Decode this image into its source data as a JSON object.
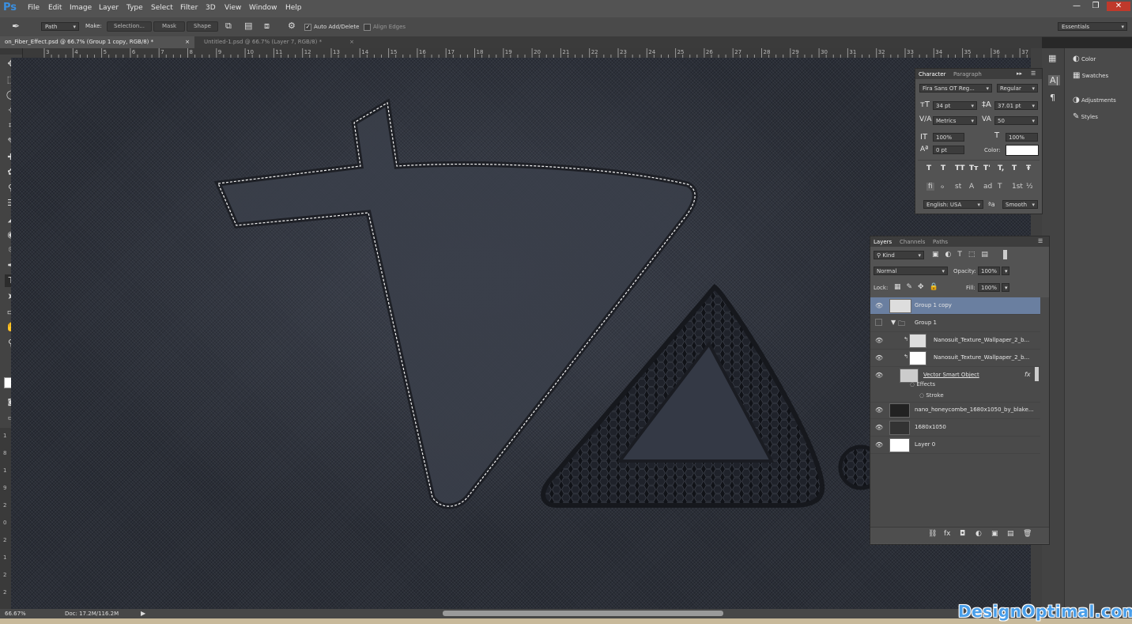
{
  "app": {
    "logo": "Ps"
  },
  "menu": [
    "File",
    "Edit",
    "Image",
    "Layer",
    "Type",
    "Select",
    "Filter",
    "3D",
    "View",
    "Window",
    "Help"
  ],
  "window_controls": [
    "—",
    "❐",
    "✕"
  ],
  "options": {
    "mode": "Path",
    "make_label": "Make:",
    "selection_btn": "Selection...",
    "mask_btn": "Mask",
    "shape_btn": "Shape",
    "auto_add_delete": "Auto Add/Delete",
    "align_edges": "Align Edges",
    "workspace": "Essentials"
  },
  "doc_tabs": [
    {
      "label": "on_Fiber_Effect.psd @ 66.7% (Group 1 copy, RGB/8) *",
      "active": true
    },
    {
      "label": "Untitled-1.psd @ 66.7% (Layer 7, RGB/8) *",
      "active": false
    }
  ],
  "ruler_h": [
    "3",
    "4",
    "5",
    "6",
    "7",
    "8",
    "9",
    "10",
    "11",
    "12",
    "13",
    "14",
    "15",
    "16",
    "17",
    "18",
    "19",
    "20",
    "21",
    "22",
    "23",
    "24",
    "25",
    "26",
    "27",
    "28",
    "29",
    "30",
    "31",
    "32",
    "33",
    "34",
    "35",
    "36",
    "37"
  ],
  "ruler_v": [
    "1",
    "8",
    "1",
    "9",
    "2",
    "0",
    "2",
    "1",
    "2",
    "2"
  ],
  "tools": [
    "✥",
    "⬚",
    "◯",
    "✧",
    "⌗",
    "✎",
    "✚",
    "✿",
    "⚲",
    "☰",
    "◢",
    "◉",
    "⌾",
    "✒",
    "T",
    "➤",
    "▭",
    "✋",
    "⚲"
  ],
  "status": {
    "zoom": "66.67%",
    "doc": "Doc: 17.2M/116.2M"
  },
  "dock": {
    "items": [
      "Color",
      "Swatches",
      "Adjustments",
      "Styles"
    ]
  },
  "character": {
    "tabs": [
      "Character",
      "Paragraph"
    ],
    "font_family": "Fira Sans OT Reg...",
    "font_style": "Regular",
    "size": "34 pt",
    "leading": "37.01 pt",
    "kerning": "Metrics",
    "tracking": "50",
    "vscale": "100%",
    "hscale": "100%",
    "baseline": "0 pt",
    "color_label": "Color:",
    "style_buttons": [
      "T",
      "T",
      "TT",
      "Tт",
      "T'",
      "T,",
      "T",
      "Ŧ"
    ],
    "ot_buttons": [
      "fi",
      "ℴ",
      "st",
      "A",
      "ad",
      "T",
      "1st",
      "½"
    ],
    "language": "English: USA",
    "aa_label": "ªa",
    "antialias": "Smooth"
  },
  "layers": {
    "tabs": [
      "Layers",
      "Channels",
      "Paths"
    ],
    "kind": "Kind",
    "blend": "Normal",
    "opacity_label": "Opacity:",
    "opacity": "100%",
    "lock_label": "Lock:",
    "fill_label": "Fill:",
    "fill": "100%",
    "rows": [
      {
        "name": "Group 1 copy",
        "selected": true,
        "eye": true
      },
      {
        "name": "Group 1",
        "folder": true,
        "eye": false
      },
      {
        "name": "Nanosuit_Texture_Wallpaper_2_b...",
        "indent": true,
        "eye": true
      },
      {
        "name": "Nanosuit_Texture_Wallpaper_2_b...",
        "indent": true,
        "eye": true
      },
      {
        "name": "Vector Smart Object",
        "fx": "fx",
        "eye": true
      },
      {
        "name": "Effects",
        "sub": true
      },
      {
        "name": "Stroke",
        "sub": true
      },
      {
        "name": "nano_honeycombe_1680x1050_by_blake...",
        "eye": true
      },
      {
        "name": "1680x1050",
        "eye": true
      },
      {
        "name": "Layer 0",
        "eye": true,
        "white": true
      }
    ],
    "footer_icons": [
      "⛓",
      "fx",
      "◘",
      "◐",
      "▣",
      "▤",
      "🗑"
    ]
  },
  "watermark": "DesignOptimal.com"
}
